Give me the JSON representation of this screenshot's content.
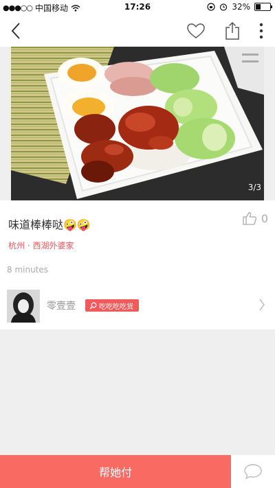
{
  "status_bar": {
    "carrier": "中国移动",
    "time": "17:26",
    "battery": "32%",
    "battery_level": 0.32
  },
  "nav": {
    "back_icon": "chevron-left-icon",
    "like_icon": "heart-icon",
    "share_icon": "share-icon",
    "more_icon": "more-vertical-icon"
  },
  "photo": {
    "page_indicator": "3/3"
  },
  "post": {
    "title": "味道棒棒哒🤪🤪",
    "like_count": "0",
    "location": "杭州 · 西湖外婆家",
    "time_ago": "8 minutes",
    "user": {
      "name": "零壹壹",
      "tag": "吃吃吃吃货"
    }
  },
  "bottom": {
    "pay_label": "帮她付",
    "comment_icon": "chat-bubble-icon"
  },
  "colors": {
    "accent": "#f96a63",
    "location": "#f0555a",
    "tag_bg": "#f05a5a"
  }
}
